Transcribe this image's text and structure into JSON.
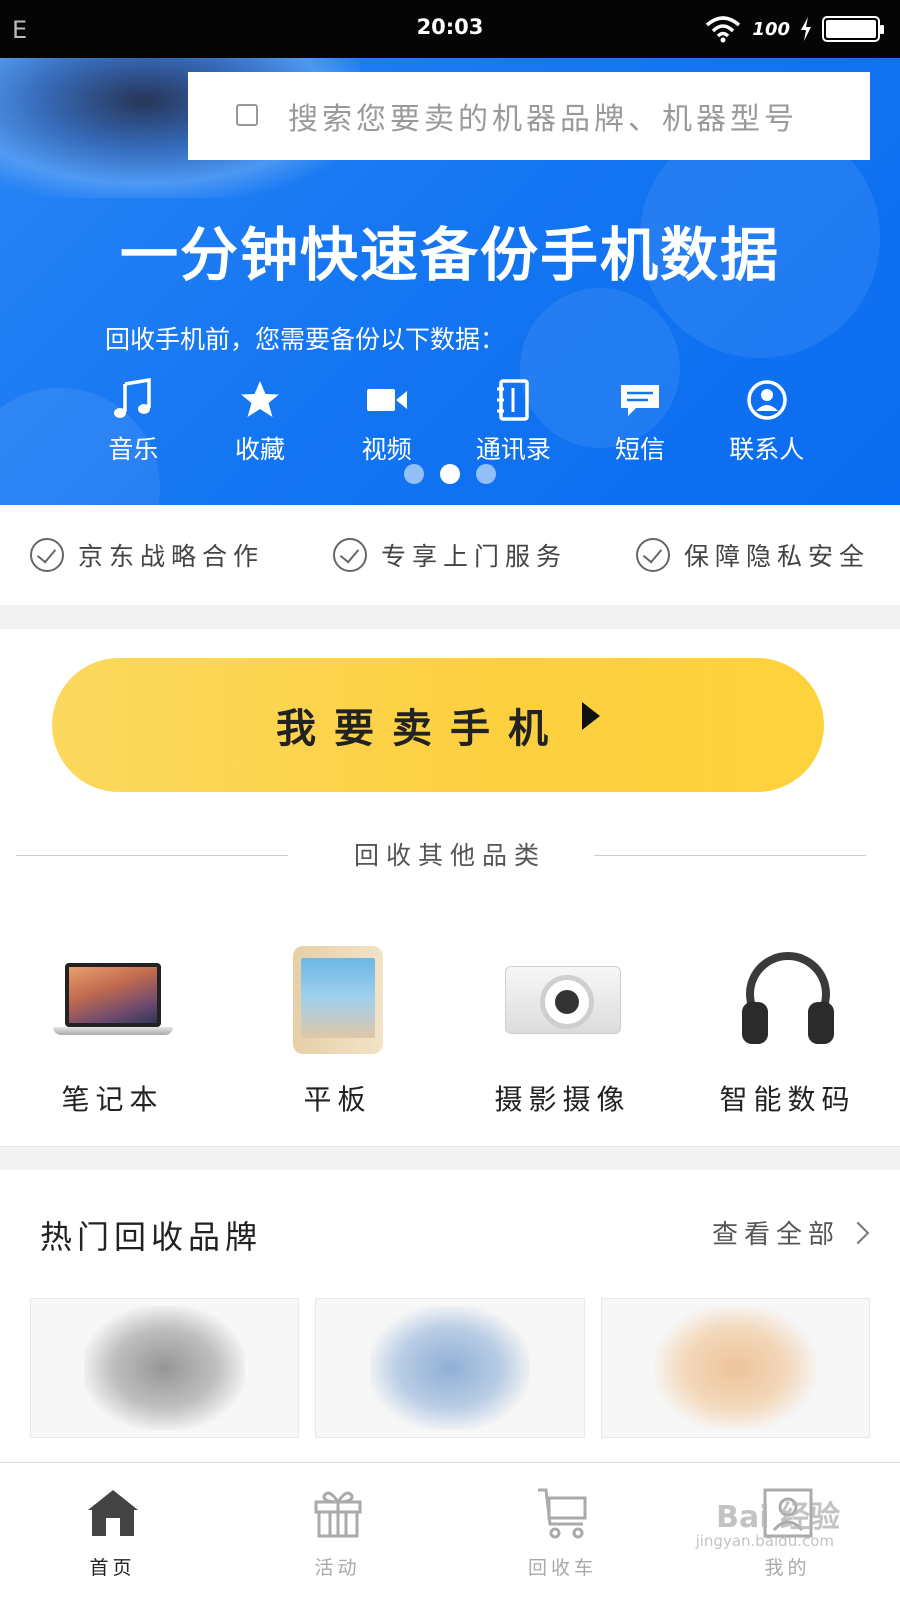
{
  "status_bar": {
    "left": "E",
    "time": "20:03",
    "battery_text": "100",
    "battery_level_pct": 100
  },
  "banner": {
    "search_placeholder": "搜索您要卖的机器品牌、机器型号",
    "title": "一分钟快速备份手机数据",
    "subtitle": "回收手机前，您需要备份以下数据：",
    "items": [
      {
        "icon": "music-icon",
        "label": "音乐"
      },
      {
        "icon": "star-icon",
        "label": "收藏"
      },
      {
        "icon": "video-icon",
        "label": "视频"
      },
      {
        "icon": "address-book-icon",
        "label": "通讯录"
      },
      {
        "icon": "message-icon",
        "label": "短信"
      },
      {
        "icon": "contact-icon",
        "label": "联系人"
      }
    ],
    "carousel_count": 3,
    "carousel_active_index": 1,
    "colors": {
      "primary": "#1576f2"
    }
  },
  "features": [
    {
      "label": "京东战略合作"
    },
    {
      "label": "专享上门服务"
    },
    {
      "label": "保障隐私安全"
    }
  ],
  "sell_button": {
    "label": "我要卖手机",
    "color": "#fcd244"
  },
  "other_categories": {
    "title": "回收其他品类",
    "items": [
      {
        "icon": "laptop-icon",
        "label": "笔记本"
      },
      {
        "icon": "tablet-icon",
        "label": "平板"
      },
      {
        "icon": "camera-icon",
        "label": "摄影摄像"
      },
      {
        "icon": "headphones-icon",
        "label": "智能数码"
      }
    ]
  },
  "hot_brands": {
    "title": "热门回收品牌",
    "view_all": "查看全部"
  },
  "bottom_nav": [
    {
      "icon": "home-icon",
      "label": "首页",
      "active": true
    },
    {
      "icon": "gift-icon",
      "label": "活动",
      "active": false
    },
    {
      "icon": "cart-icon",
      "label": "回收车",
      "active": false
    },
    {
      "icon": "profile-icon",
      "label": "我的",
      "active": false
    }
  ],
  "watermark": {
    "main": "Bai 经验",
    "sub": "jingyan.baidu.com"
  }
}
